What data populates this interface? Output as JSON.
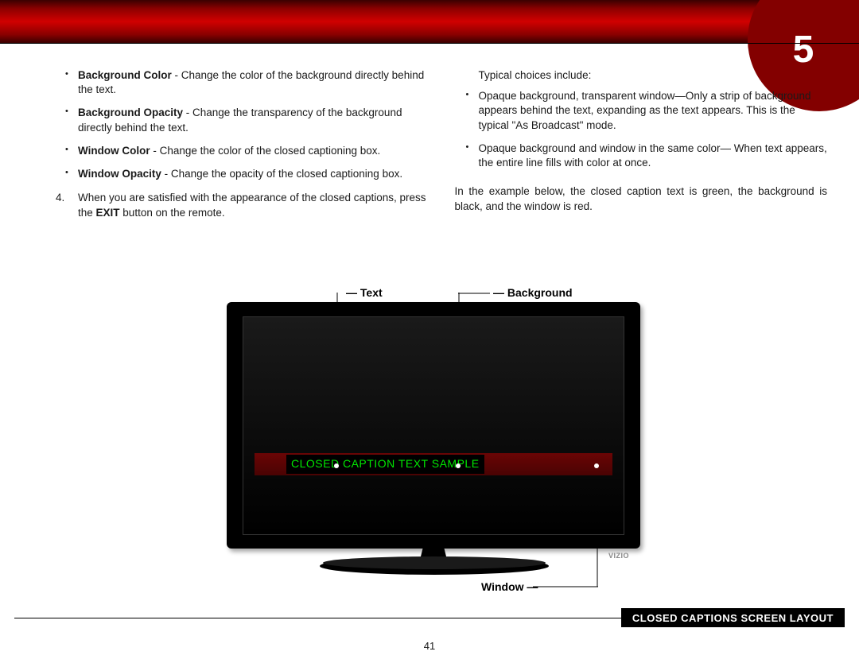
{
  "chapter_number": "5",
  "page_number": "41",
  "left_column": {
    "bullets": [
      {
        "term": "Background Color",
        "desc": " - Change the color of the background directly behind the text."
      },
      {
        "term": "Background Opacity",
        "desc": " - Change the transparency of the background directly behind the text."
      },
      {
        "term": "Window Color",
        "desc": " - Change the color of the closed captioning box."
      },
      {
        "term": "Window Opacity",
        "desc": " - Change the opacity of the closed captioning box."
      }
    ],
    "step4_before": "When you are satisfied with the appearance of the closed captions, press the ",
    "step4_bold": "EXIT",
    "step4_after": " button on the remote."
  },
  "right_column": {
    "intro": "Typical choices include:",
    "bullets": [
      "Opaque background, transparent window—Only a strip of background appears behind the text, expanding as the text appears. This is the typical \"As Broadcast\" mode.",
      "Opaque background and window in the same color— When text appears, the entire line fills with color at once."
    ],
    "outro": "In the example below, the closed caption text is green, the background is black, and the window is red."
  },
  "diagram": {
    "label_text": "Text",
    "label_background": "Background",
    "label_window": "Window",
    "tv_logo": "VIZIO",
    "caption_sample": "CLOSED CAPTION TEXT SAMPLE",
    "figure_title": "CLOSED CAPTIONS SCREEN LAYOUT"
  }
}
